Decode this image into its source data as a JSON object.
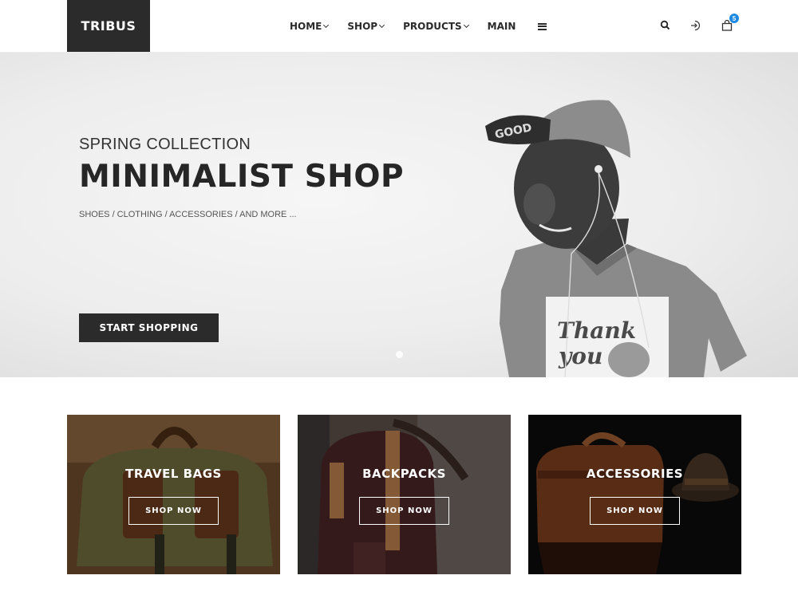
{
  "header": {
    "logo": "TRIBUS",
    "nav": [
      {
        "label": "HOME",
        "has_dropdown": true
      },
      {
        "label": "SHOP",
        "has_dropdown": true
      },
      {
        "label": "PRODUCTS",
        "has_dropdown": true
      },
      {
        "label": "MAIN",
        "has_dropdown": false
      }
    ],
    "icons": [
      "search-icon",
      "sign-in-icon",
      "shopping-bag-icon"
    ],
    "cart_count": "5",
    "badge_color": "#1e88e5"
  },
  "hero": {
    "subtitle": "SPRING COLLECTION",
    "title": "MINIMALIST SHOP",
    "tags": "SHOES / CLOTHING / ACCESSORIES / AND MORE ...",
    "button_label": "START SHOPPING",
    "button_color": "#2b2b2b",
    "tshirt_text_1": "Thank",
    "tshirt_text_2": "you"
  },
  "categories": [
    {
      "title": "TRAVEL BAGS",
      "button_label": "SHOP NOW"
    },
    {
      "title": "BACKPACKS",
      "button_label": "SHOP NOW"
    },
    {
      "title": "ACCESSORIES",
      "button_label": "SHOP NOW"
    }
  ]
}
